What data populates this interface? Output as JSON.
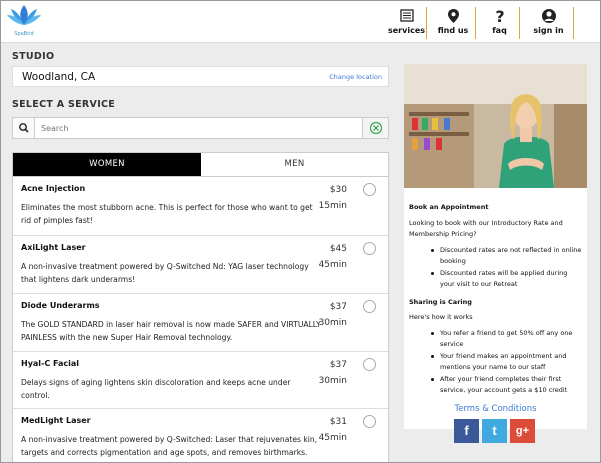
{
  "header": {
    "logo_text": "SpaBrid",
    "nav": [
      {
        "label": "services",
        "icon": "services-icon"
      },
      {
        "label": "find us",
        "icon": "location-pin-icon"
      },
      {
        "label": "faq",
        "icon": "question-icon"
      },
      {
        "label": "sign in",
        "icon": "user-icon"
      }
    ]
  },
  "studio": {
    "title": "STUDIO",
    "name": "Woodland, CA",
    "change_label": "Change location"
  },
  "service_select": {
    "title": "SELECT A SERVICE",
    "search_placeholder": "Search",
    "tabs": [
      "WOMEN",
      "MEN"
    ],
    "active_tab": "WOMEN"
  },
  "services": [
    {
      "name": "Acne Injection",
      "description": "Eliminates the most stubborn acne. This is perfect for those who want to get rid of pimples fast!",
      "price": "$30",
      "duration": "15min"
    },
    {
      "name": "AxiLight Laser",
      "description": "A non-invasive treatment powered by Q-Switched Nd: YAG laser technology that lightens dark underarms!",
      "price": "$45",
      "duration": "45min"
    },
    {
      "name": "Diode Underarms",
      "description": "The GOLD STANDARD in laser hair removal is now made SAFER and VIRTUALLY PAINLESS with the new Super Hair Removal technology.",
      "price": "$37",
      "duration": "30min"
    },
    {
      "name": "Hyal-C Facial",
      "description": "Delays signs of aging lightens skin discoloration and keeps acne under control.",
      "price": "$37",
      "duration": "30min"
    },
    {
      "name": "MedLight Laser",
      "description": "A non-invasive treatment powered by Q-Switched: Laser that rejuvenates kin, targets and corrects pigmentation and age spots, and removes birthmarks.",
      "price": "$31",
      "duration": "45min"
    }
  ],
  "panel": {
    "book_title": "Book an Appointment",
    "book_text": "Looking to book with our Introductory Rate and Membership Pricing?",
    "book_points": [
      "Discounted rates are not reflected in online booking",
      "Discounted rates will be applied during your visit to our Retreat"
    ],
    "share_title": "Sharing is Caring",
    "share_text": "Here's how it works",
    "share_points": [
      "You refer a friend to get 50% off any one service",
      "Your friend makes an appointment and mentions your name to our staff",
      "After your friend completes their first service, your account gets a $10 credit"
    ],
    "terms_label": "Terms & Conditions",
    "social": [
      "f",
      "t",
      "g+"
    ]
  },
  "colors": {
    "accent_orange": "#e2a13b",
    "link_blue": "#3c7bd4",
    "tab_active_bg": "#000000",
    "facebook": "#3b5998",
    "twitter": "#3fa9e0",
    "google_plus": "#dd4b39"
  }
}
